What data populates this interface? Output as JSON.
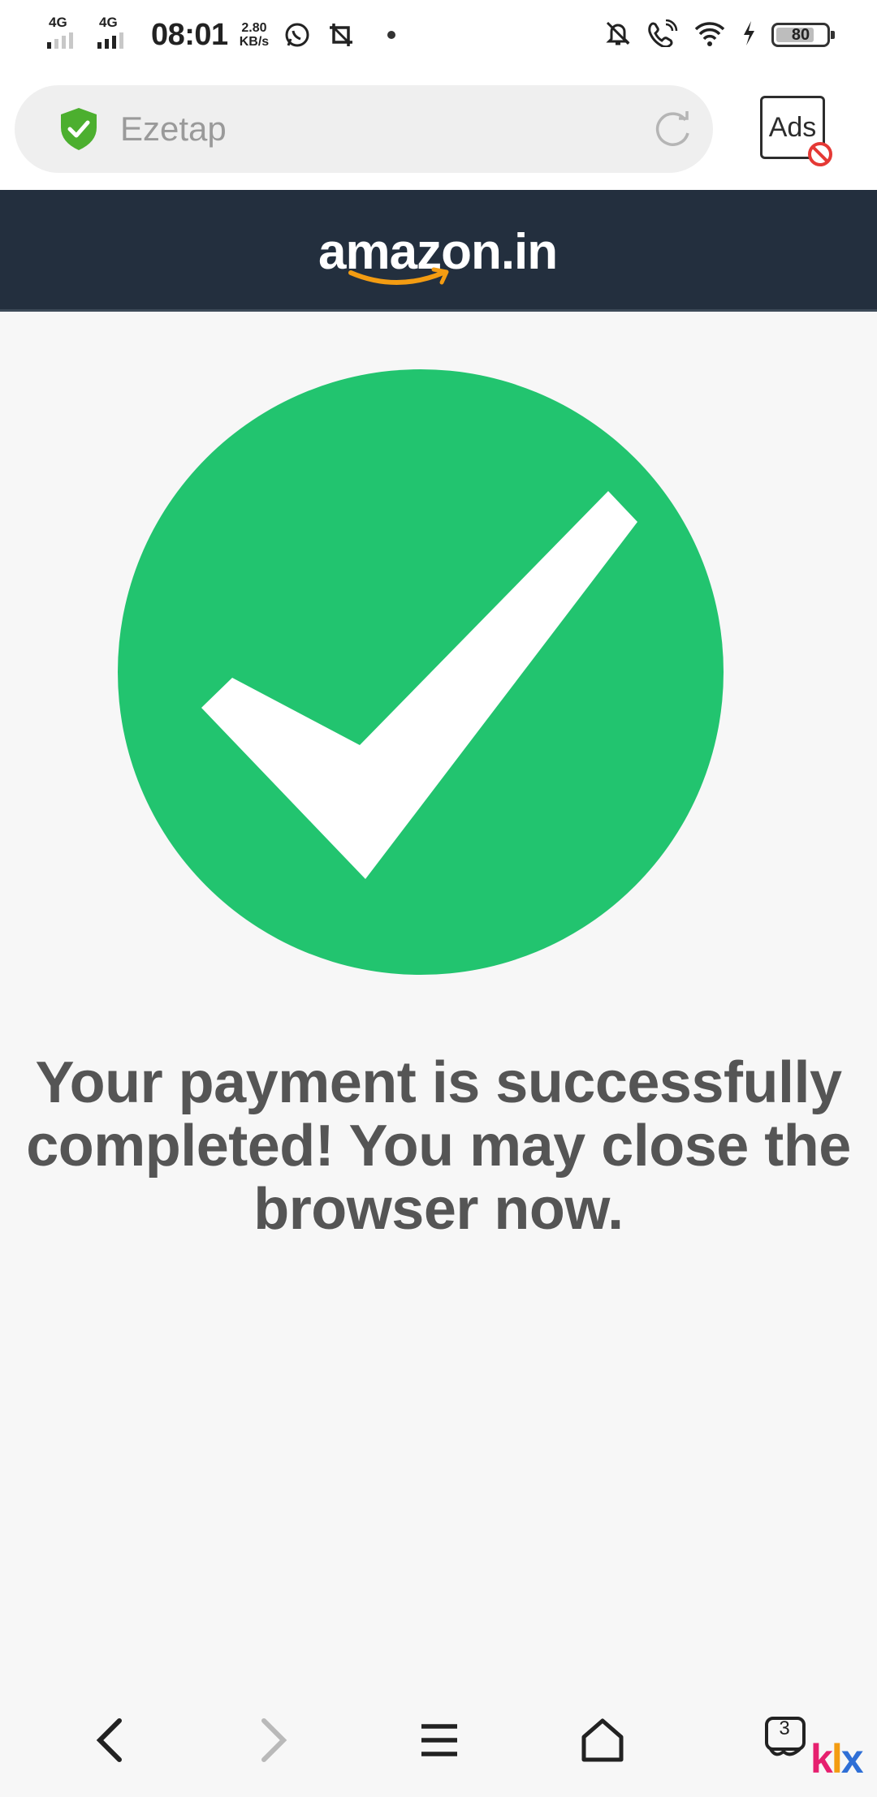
{
  "status_bar": {
    "net1_label": "4G",
    "net2_label": "4G",
    "time": "08:01",
    "speed_value": "2.80",
    "speed_unit": "KB/s",
    "battery": "80"
  },
  "browser": {
    "url_text": "Ezetap",
    "ads_label": "Ads"
  },
  "header": {
    "logo_text": "amazon.in"
  },
  "content": {
    "message": "Your payment is successfully completed! You may close the browser now.",
    "check_color": "#22c46f"
  },
  "nav": {
    "tabs_count": "3",
    "watermark_k": "k",
    "watermark_l": "l",
    "watermark_x": "x"
  },
  "colors": {
    "header_bg": "#232f3e",
    "shield_green": "#4caf2f",
    "block_red": "#e53935"
  }
}
